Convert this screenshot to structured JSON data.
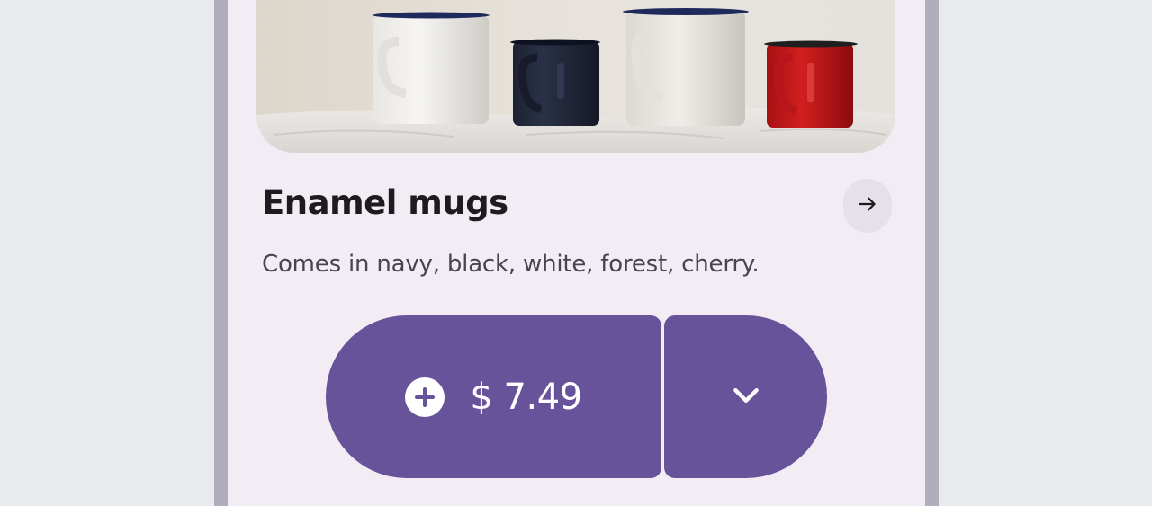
{
  "product": {
    "image_alt": "Four enamel mugs on a white cloth",
    "title": "Enamel mugs",
    "description": "Comes in navy, black, white, forest, cherry."
  },
  "actions": {
    "details_icon": "arrow-right-icon",
    "add_icon": "add-circle-icon",
    "price_label": "$ 7.49",
    "dropdown_icon": "chevron-down-icon"
  },
  "colors": {
    "background": "#e8ebee",
    "surface": "#f2ecf4",
    "primary": "#67539a",
    "on_primary": "#ffffff",
    "title_text": "#1d1b20",
    "body_text": "#49454f",
    "tonal_button": "#e6e0e9"
  }
}
